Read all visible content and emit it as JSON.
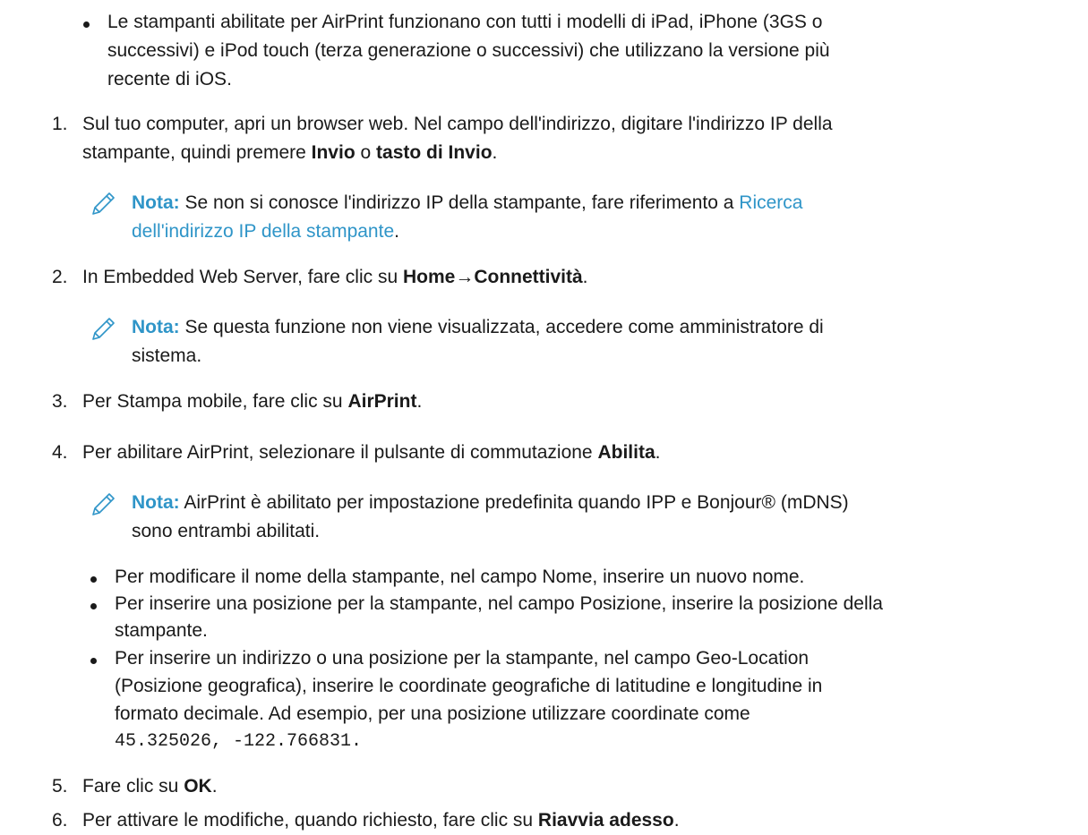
{
  "intro_bullet": {
    "line1": "Le stampanti abilitate per AirPrint funzionano con tutti i modelli di iPad, iPhone (3GS o",
    "line2": "successivi) e iPod touch (terza generazione o successivi) che utilizzano la versione più",
    "line3": "recente di iOS."
  },
  "steps": [
    {
      "num": "1.",
      "line1": "Sul tuo computer, apri un browser web. Nel campo dell'indirizzo, digitare l'indirizzo IP della",
      "line2_a": "stampante, quindi premere ",
      "line2_b": "Invio",
      "line2_c": " o ",
      "line2_d": "tasto di Invio",
      "line2_e": "."
    },
    {
      "num": "2.",
      "a": "In Embedded Web Server, fare clic su ",
      "b": "Home",
      "arrow": "→",
      "c": "Connettività",
      "d": "."
    },
    {
      "num": "3.",
      "a": "Per Stampa mobile, fare clic su ",
      "b": "AirPrint",
      "c": "."
    },
    {
      "num": "4.",
      "a": "Per abilitare AirPrint, selezionare il pulsante di commutazione ",
      "b": "Abilita",
      "c": "."
    },
    {
      "num": "5.",
      "a": "Fare clic su ",
      "b": "OK",
      "c": "."
    },
    {
      "num": "6.",
      "a": "Per attivare le modifiche, quando richiesto, fare clic su ",
      "b": "Riavvia adesso",
      "c": "."
    }
  ],
  "notes": [
    {
      "label": "Nota:",
      "line1": " Se non si conosce l'indirizzo IP della stampante, fare riferimento a ",
      "link1": "Ricerca",
      "link2": "dell'indirizzo IP della stampante",
      "end": "."
    },
    {
      "label": "Nota:",
      "line1": " Se questa funzione non viene visualizzata, accedere come amministratore di",
      "line2": "sistema."
    },
    {
      "label": "Nota:",
      "line1": " AirPrint è abilitato per impostazione predefinita quando IPP e Bonjour® (mDNS)",
      "line2": "sono entrambi abilitati."
    }
  ],
  "sub_bullets": [
    {
      "line1": "Per modificare il nome della stampante, nel campo Nome, inserire un nuovo nome."
    },
    {
      "line1": "Per inserire una posizione per la stampante, nel campo Posizione, inserire la posizione della",
      "line2": "stampante."
    },
    {
      "line1": "Per inserire un indirizzo o una posizione per la stampante, nel campo Geo-Location",
      "line2": "(Posizione geografica), inserire le coordinate geografiche di latitudine e longitudine in",
      "line3": "formato decimale. Ad esempio, per una posizione utilizzare coordinate come",
      "code": "45.325026, -122.766831."
    }
  ],
  "icons": {
    "note": "pencil-icon"
  },
  "colors": {
    "accent": "#2f95c8",
    "text": "#1a1a1a"
  }
}
